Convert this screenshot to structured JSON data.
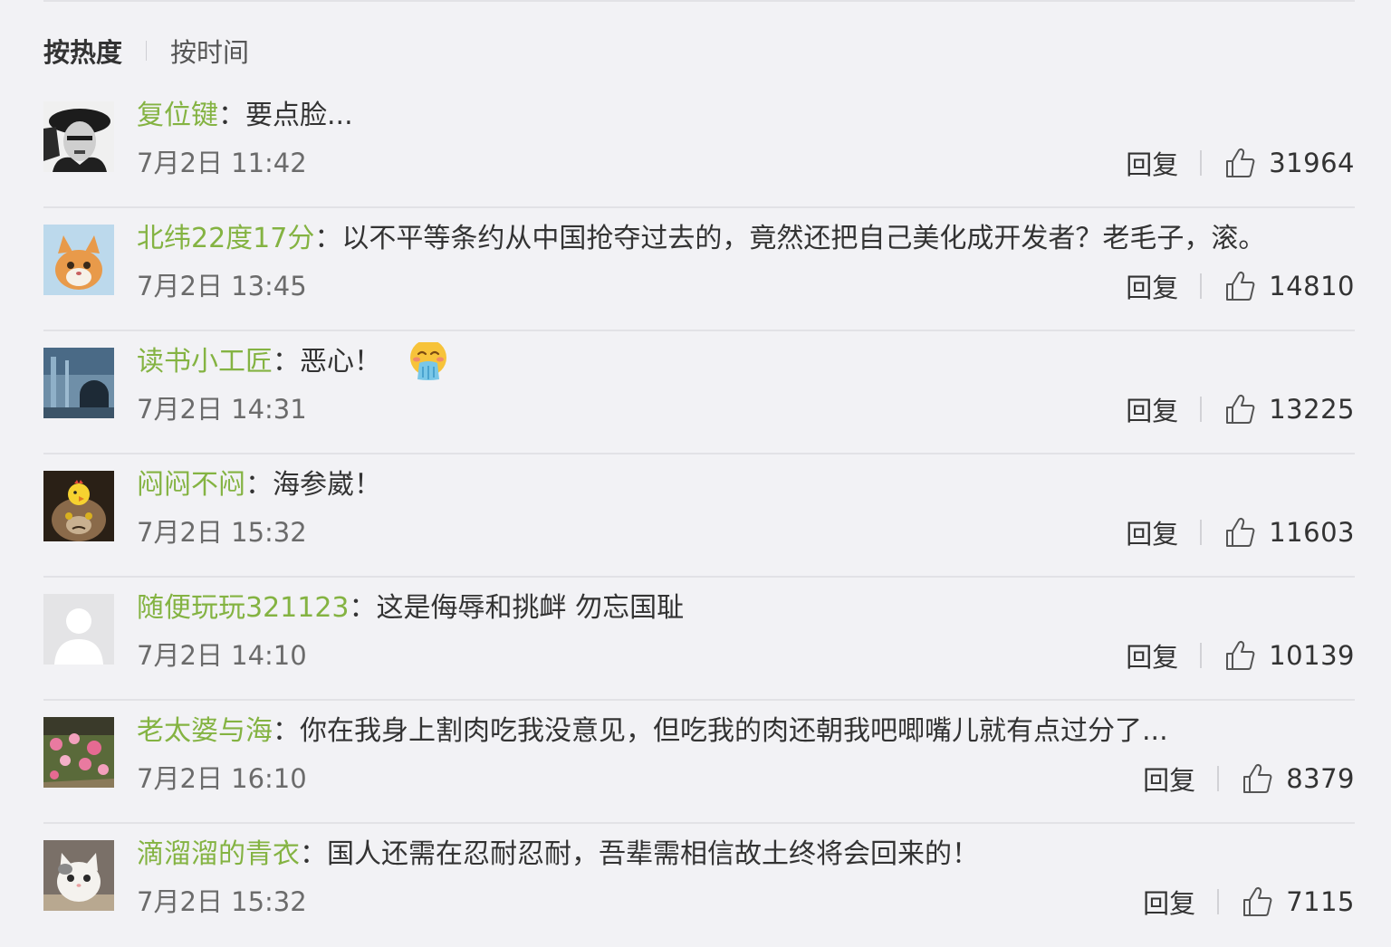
{
  "sort": {
    "hot_label": "按热度",
    "time_label": "按时间"
  },
  "reply_label": "回复",
  "colors": {
    "username": "#84b342",
    "background": "#f2f2f5",
    "divider": "#e2e2e6"
  },
  "comments": [
    {
      "username": "复位键",
      "text": "要点脸...",
      "time": "7月2日 11:42",
      "likes": "31964",
      "avatar": "black-white-portrait",
      "emoji": ""
    },
    {
      "username": "北纬22度17分",
      "text": "以不平等条约从中国抢夺过去的，竟然还把自己美化成开发者？老毛子，滚。",
      "time": "7月2日 13:45",
      "likes": "14810",
      "avatar": "orange-cat",
      "emoji": ""
    },
    {
      "username": "读书小工匠",
      "text": "恶心！",
      "time": "7月2日 14:31",
      "likes": "13225",
      "avatar": "tunnel-scene",
      "emoji": "vomit-emoji"
    },
    {
      "username": "闷闷不闷",
      "text": "海参崴！",
      "time": "7月2日 15:32",
      "likes": "11603",
      "avatar": "grumpy-cat-with-chick",
      "emoji": ""
    },
    {
      "username": "随便玩玩321123",
      "text": "这是侮辱和挑衅 勿忘国耻",
      "time": "7月2日 14:10",
      "likes": "10139",
      "avatar": "default-avatar",
      "emoji": ""
    },
    {
      "username": "老太婆与海",
      "text": "你在我身上割肉吃我没意见，但吃我的肉还朝我吧唧嘴儿就有点过分了...",
      "time": "7月2日 16:10",
      "likes": "8379",
      "avatar": "pink-flowers",
      "emoji": ""
    },
    {
      "username": "滴溜溜的青衣",
      "text": "国人还需在忍耐忍耐，吾辈需相信故土终将会回来的！",
      "time": "7月2日 15:32",
      "likes": "7115",
      "avatar": "white-kitten",
      "emoji": ""
    }
  ]
}
